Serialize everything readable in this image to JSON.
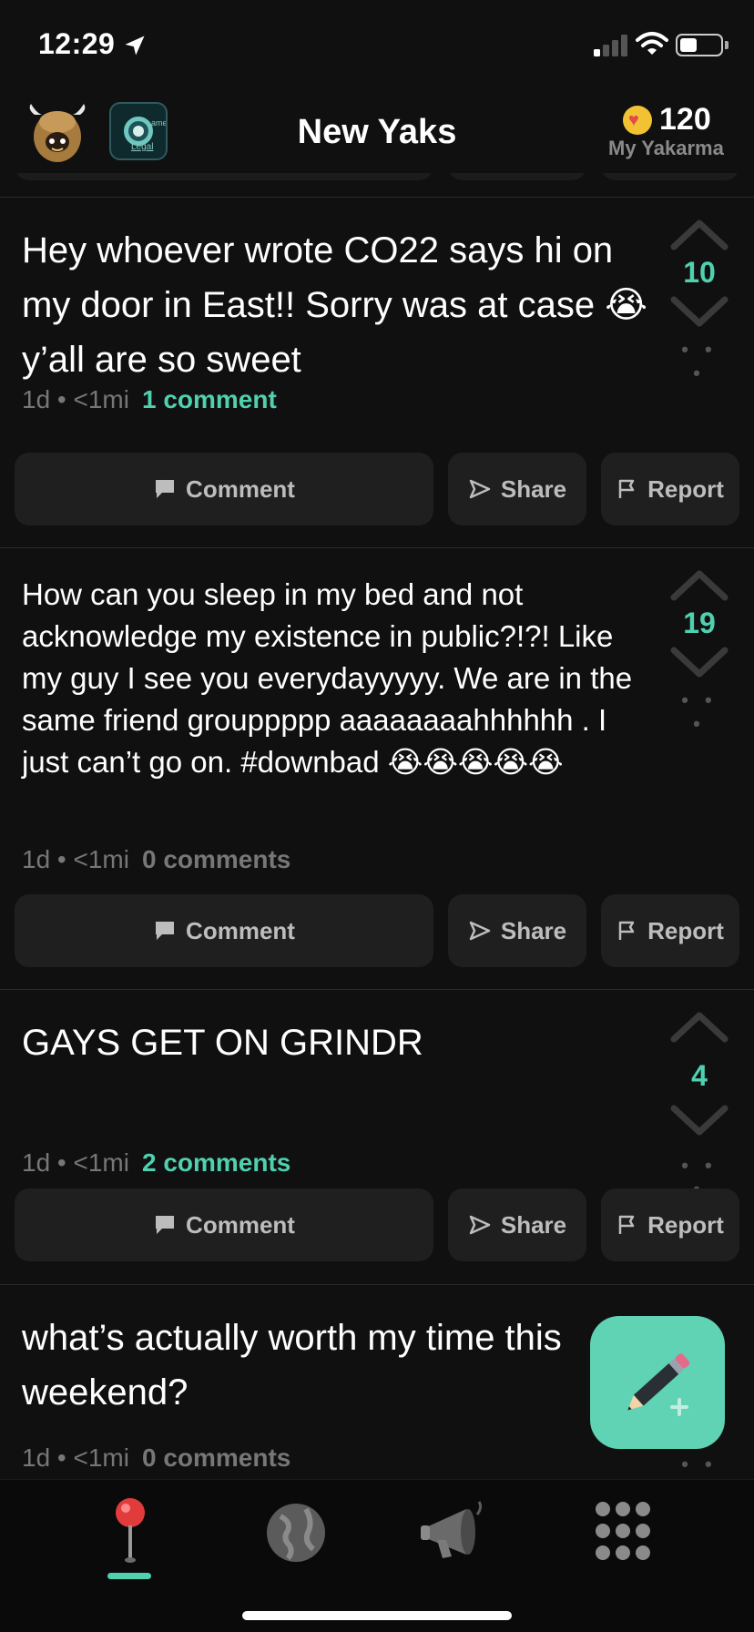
{
  "status_bar": {
    "time": "12:29"
  },
  "header": {
    "title": "New Yaks",
    "karma_value": "120",
    "karma_label": "My Yakarma",
    "badge_text_top": "ame",
    "badge_text_bottom": "Legal"
  },
  "posts": [
    {
      "text": "Hey whoever wrote CO22 says hi on my door in East!! Sorry was at case 😭 y’all are so sweet",
      "meta": "1d • <1mi",
      "comments": "1 comment",
      "votes": "10"
    },
    {
      "text": "How can you sleep in my bed and not acknowledge my existence in public?!?! Like my guy I see you everydayyyyy. We are in the same friend grouppppp aaaaaaaahhhhhh . I just can’t go on. #downbad 😭😭😭😭😭",
      "meta": "1d • <1mi",
      "comments": "0 comments",
      "votes": "19"
    },
    {
      "text": "GAYS GET ON GRINDR",
      "meta": "1d • <1mi",
      "comments": "2 comments",
      "votes": "4"
    },
    {
      "text": "what’s actually worth my time this weekend?",
      "meta": "1d • <1mi",
      "comments": "0 comments"
    }
  ],
  "actions": {
    "comment_label": "Comment",
    "share_label": "Share",
    "report_label": "Report"
  },
  "vote_more": "• • •",
  "tabs": [
    "pin-icon",
    "globe-icon",
    "megaphone-icon",
    "grid-icon"
  ],
  "colors": {
    "accent": "#4fd1b0",
    "fab": "#5fd3b3",
    "background": "#101010",
    "button": "#1f1f1f"
  }
}
